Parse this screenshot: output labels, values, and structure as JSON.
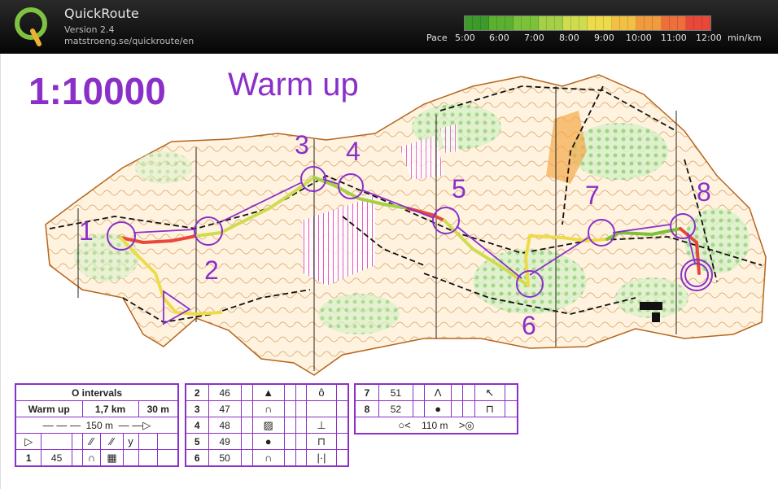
{
  "app": {
    "title": "QuickRoute",
    "version": "Version 2.4",
    "url": "matstroeng.se/quickroute/en"
  },
  "pace": {
    "label": "Pace",
    "ticks": [
      "5:00",
      "6:00",
      "7:00",
      "8:00",
      "9:00",
      "10:00",
      "11:00",
      "12:00"
    ],
    "unit": "min/km",
    "gradient": [
      "#3c9a2a",
      "#5bb030",
      "#7cc13a",
      "#a4d048",
      "#cfdc4e",
      "#eedb4a",
      "#f3c046",
      "#f29a3e",
      "#ee6f3a",
      "#e8483a"
    ]
  },
  "map": {
    "scale": "1:10000",
    "course_title": "Warm up",
    "controls": [
      "1",
      "2",
      "3",
      "4",
      "5",
      "6",
      "7",
      "8"
    ]
  },
  "descriptions": {
    "header": {
      "title": "O intervals",
      "course": "Warm up",
      "length": "1,7 km",
      "climb": "30 m"
    },
    "start_line": "150 m",
    "finish_line": "110 m",
    "rows_left": [
      {
        "num": "1",
        "code": "45"
      }
    ],
    "rows_mid": [
      {
        "num": "2",
        "code": "46"
      },
      {
        "num": "3",
        "code": "47"
      },
      {
        "num": "4",
        "code": "48"
      },
      {
        "num": "5",
        "code": "49"
      },
      {
        "num": "6",
        "code": "50"
      }
    ],
    "rows_right": [
      {
        "num": "7",
        "code": "51"
      },
      {
        "num": "8",
        "code": "52"
      }
    ]
  },
  "colors": {
    "course": "#8b2fc9",
    "route_fast": "#3c9a2a",
    "route_slow": "#e8483a"
  }
}
